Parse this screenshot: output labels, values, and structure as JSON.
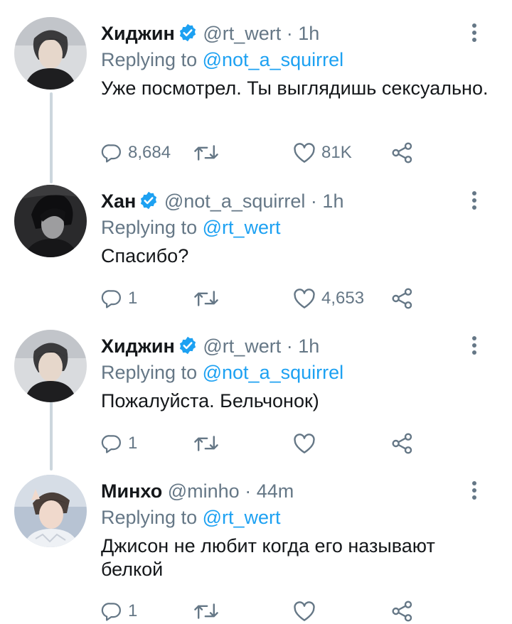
{
  "colors": {
    "accent": "#1da1f2",
    "muted": "#657786",
    "text": "#14171a",
    "thread_line": "#ccd6dd"
  },
  "tweets": [
    {
      "name": "Хиджин",
      "verified": true,
      "handle": "@rt_wert",
      "dot": "·",
      "time": "1h",
      "replying_label": "Replying to",
      "replying_to": "@not_a_squirrel",
      "text": "Уже посмотрел. Ты выглядишь сексуально.",
      "reply_count": "8,684",
      "retweet_count": "",
      "like_count": "81K"
    },
    {
      "name": "Хан",
      "verified": true,
      "handle": "@not_a_squirrel",
      "dot": "·",
      "time": "1h",
      "replying_label": "Replying to",
      "replying_to": "@rt_wert",
      "text": "Спасибо?",
      "reply_count": "1",
      "retweet_count": "",
      "like_count": "4,653"
    },
    {
      "name": "Хиджин",
      "verified": true,
      "handle": "@rt_wert",
      "dot": "·",
      "time": "1h",
      "replying_label": "Replying to",
      "replying_to": "@not_a_squirrel",
      "text": "Пожалуйста. Бельчонок)",
      "reply_count": "1",
      "retweet_count": "",
      "like_count": ""
    },
    {
      "name": "Минхо",
      "verified": false,
      "handle": "@minho",
      "dot": "·",
      "time": "44m",
      "replying_label": "Replying to",
      "replying_to": "@rt_wert",
      "text": "Джисон не любит когда его называют белкой",
      "reply_count": "1",
      "retweet_count": "",
      "like_count": ""
    }
  ]
}
